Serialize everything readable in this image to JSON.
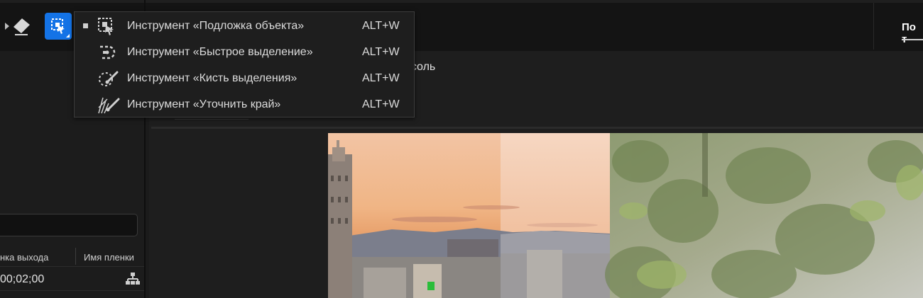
{
  "toolbar": {
    "tools": [
      {
        "icon": "tool-partial-icon"
      },
      {
        "icon": "eraser-icon"
      },
      {
        "icon": "object-matte-tool-icon",
        "active": true
      }
    ]
  },
  "selection_menu": {
    "items": [
      {
        "label": "Инструмент «Подложка объекта»",
        "shortcut": "ALT+W",
        "icon": "object-matte-icon",
        "checked": true
      },
      {
        "label": "Инструмент «Быстрое выделение»",
        "shortcut": "ALT+W",
        "icon": "quick-selection-icon",
        "checked": false
      },
      {
        "label": "Инструмент «Кисть выделения»",
        "shortcut": "ALT+W",
        "icon": "selection-brush-icon",
        "checked": false
      },
      {
        "label": "Инструмент «Уточнить край»",
        "shortcut": "ALT+W",
        "icon": "refine-edge-icon",
        "checked": false
      }
    ]
  },
  "top_right_tab": "По т",
  "main": {
    "console_text": "нсоль"
  },
  "left_panel": {
    "col_out": "нка выхода",
    "col_name": "Имя пленки",
    "timecode": "00;02;00"
  },
  "colors": {
    "accent": "#1473e6",
    "background": "#1b1b1b"
  }
}
